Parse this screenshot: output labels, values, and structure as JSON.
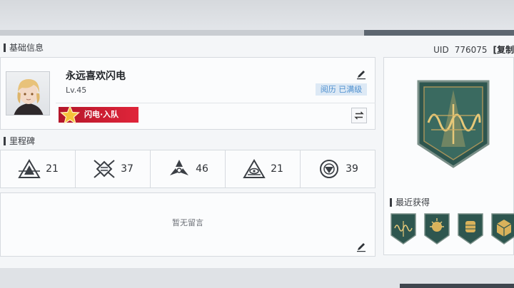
{
  "header": {
    "section_basic": "基础信息",
    "uid_label": "UID",
    "uid_value": "776075",
    "copy_label": "[复制"
  },
  "profile": {
    "name": "永远喜欢闪电",
    "level": "Lv.45",
    "experience_badge": "阅历 已满级",
    "tag_label": "闪电·入队"
  },
  "milestones": {
    "title": "里程碑",
    "items": [
      {
        "icon": "triangle-crest-icon",
        "value": "21"
      },
      {
        "icon": "crossed-shield-icon",
        "value": "37"
      },
      {
        "icon": "tri-blade-icon",
        "value": "46"
      },
      {
        "icon": "pyramid-eye-icon",
        "value": "21"
      },
      {
        "icon": "circle-compass-icon",
        "value": "39"
      }
    ]
  },
  "message": {
    "empty_text": "暂无留言"
  },
  "recent": {
    "title": "最近获得"
  },
  "colors": {
    "accent_blue": "#4d8fcf",
    "tag_red": "#d3202f",
    "badge_green": "#2f5a52",
    "gold": "#d9b25b"
  }
}
